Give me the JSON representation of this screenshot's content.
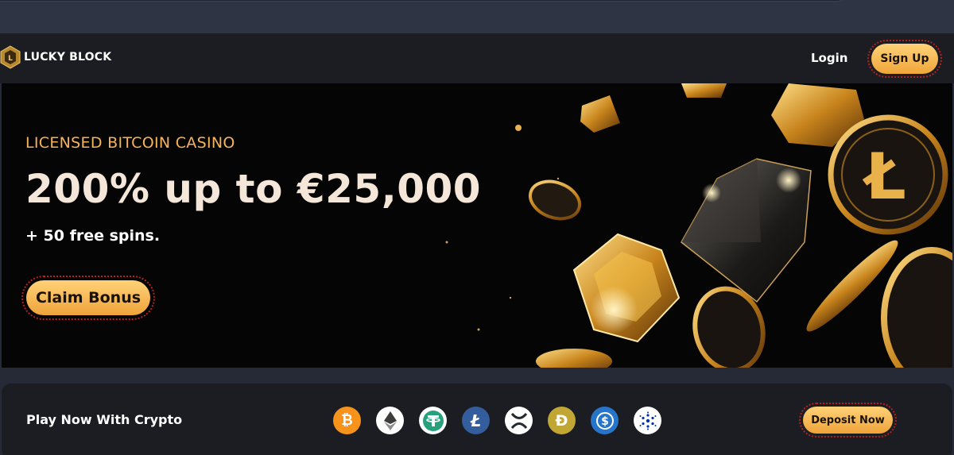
{
  "header": {
    "logo_text": "LUCKY BLOCK",
    "login_label": "Login",
    "signup_label": "Sign Up"
  },
  "hero": {
    "eyebrow": "LICENSED BITCOIN CASINO",
    "title": "200% up to €25,000",
    "subtitle": "+ 50 free spins.",
    "cta_label": "Claim Bonus"
  },
  "crypto": {
    "title": "Play Now With Crypto",
    "coins": [
      {
        "name": "bitcoin",
        "color": "#f7931a"
      },
      {
        "name": "ethereum",
        "color": "#ffffff"
      },
      {
        "name": "tether",
        "color": "#26a17b"
      },
      {
        "name": "litecoin",
        "color": "#345d9d"
      },
      {
        "name": "xrp",
        "color": "#ffffff"
      },
      {
        "name": "dogecoin",
        "color": "#c2a633"
      },
      {
        "name": "usd-coin",
        "color": "#2775ca"
      },
      {
        "name": "cardano",
        "color": "#ffffff"
      }
    ],
    "deposit_label": "Deposit Now"
  },
  "colors": {
    "accent_gold": "#f6b35b",
    "button_gradient_top": "#ffd278",
    "button_gradient_bottom": "#efa33a",
    "button_border": "#b8201f"
  }
}
